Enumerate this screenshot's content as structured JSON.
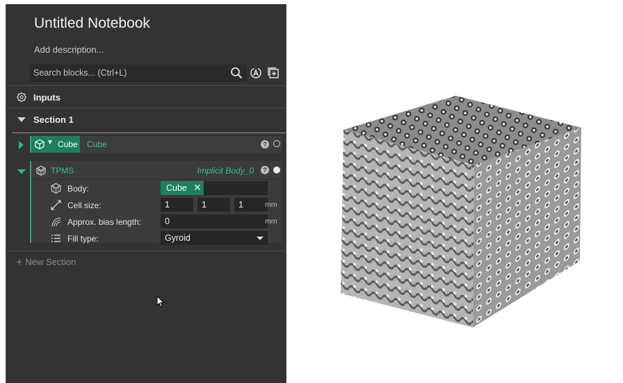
{
  "notebook": {
    "title": "Untitled Notebook",
    "description_placeholder": "Add description..."
  },
  "search": {
    "placeholder": "Search blocks... (Ctrl+L)"
  },
  "inputs": {
    "label": "Inputs"
  },
  "section": {
    "label": "Section 1"
  },
  "cube_block": {
    "type_label": "Cube",
    "name": "Cube",
    "help": "?"
  },
  "tpms_block": {
    "label": "TPMS",
    "output_name": "Implicit Body_0",
    "help": "?",
    "params": {
      "body": {
        "label": "Body:",
        "value": "Cube",
        "remove": "✕"
      },
      "cell_size": {
        "label": "Cell size:",
        "x": "1",
        "y": "1",
        "z": "1",
        "unit": "mm"
      },
      "bias": {
        "label": "Approx. bias length:",
        "value": "0",
        "unit": "mm"
      },
      "fill_type": {
        "label": "Fill type:",
        "value": "Gyroid"
      }
    }
  },
  "new_section": {
    "plus": "+",
    "label": "New Section"
  },
  "colors": {
    "panel_bg": "#333333",
    "accent_green": "#33c28e",
    "chip_green": "#1e7f5c",
    "viewport_bg": "#ffffff"
  },
  "icons": [
    "search-icon",
    "ai-assist-icon",
    "add-block-icon",
    "inputs-gear-icon",
    "cube-icon",
    "tpms-lattice-icon",
    "body-cube-icon",
    "cell-size-icon",
    "bias-icon",
    "fill-type-list-icon",
    "help-icon"
  ]
}
